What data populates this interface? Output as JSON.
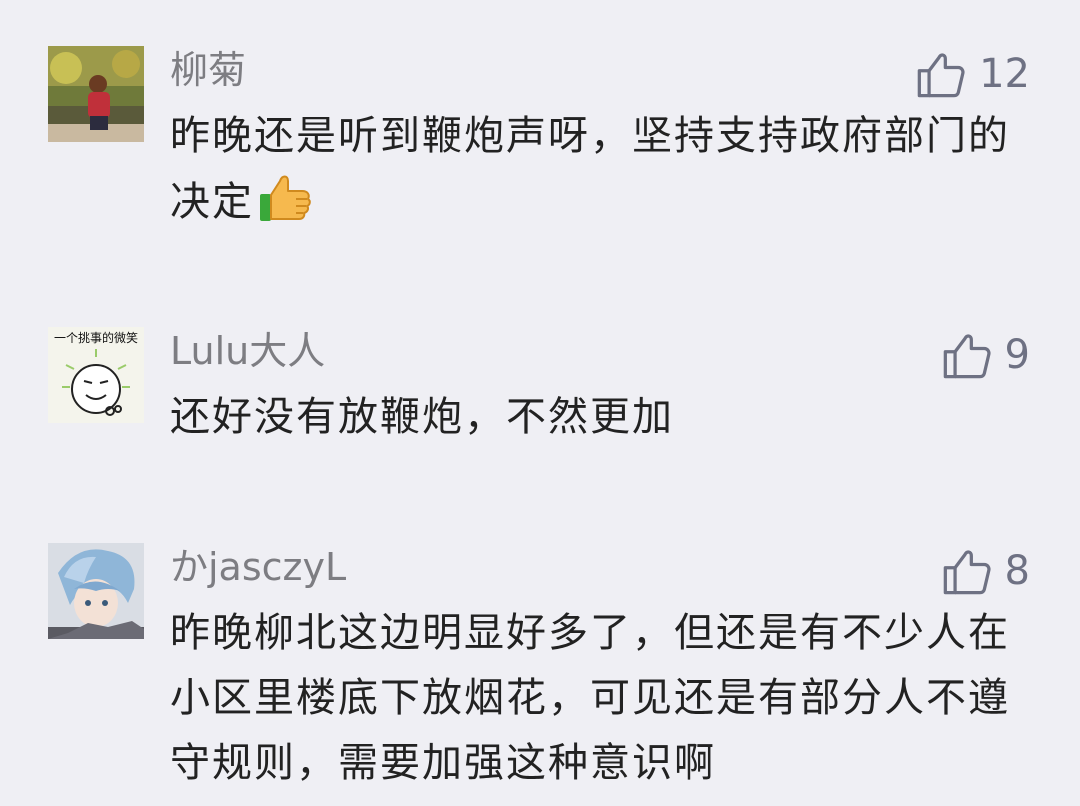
{
  "comments": [
    {
      "nickname": "柳菊",
      "like_count": "12",
      "content": "昨晚还是听到鞭炮声呀，坚持支持政府部门的决定",
      "emoji": "thumbs-up-emoji"
    },
    {
      "nickname": "Lulu大人 ",
      "avatar_text": "一个挑事的微笑",
      "like_count": "9",
      "content": "还好没有放鞭炮，不然更加"
    },
    {
      "nickname": "かjasczyL",
      "like_count": "8",
      "content": "昨晚柳北这边明显好多了，但还是有不少人在小区里楼底下放烟花，可见还是有部分人不遵守规则，需要加强这种意识啊"
    }
  ],
  "colors": {
    "background": "#efeff4",
    "nickname": "#7d7d82",
    "content": "#222222",
    "like": "#6e7183"
  },
  "icons": {
    "like": "thumbs-up-outline-icon"
  }
}
